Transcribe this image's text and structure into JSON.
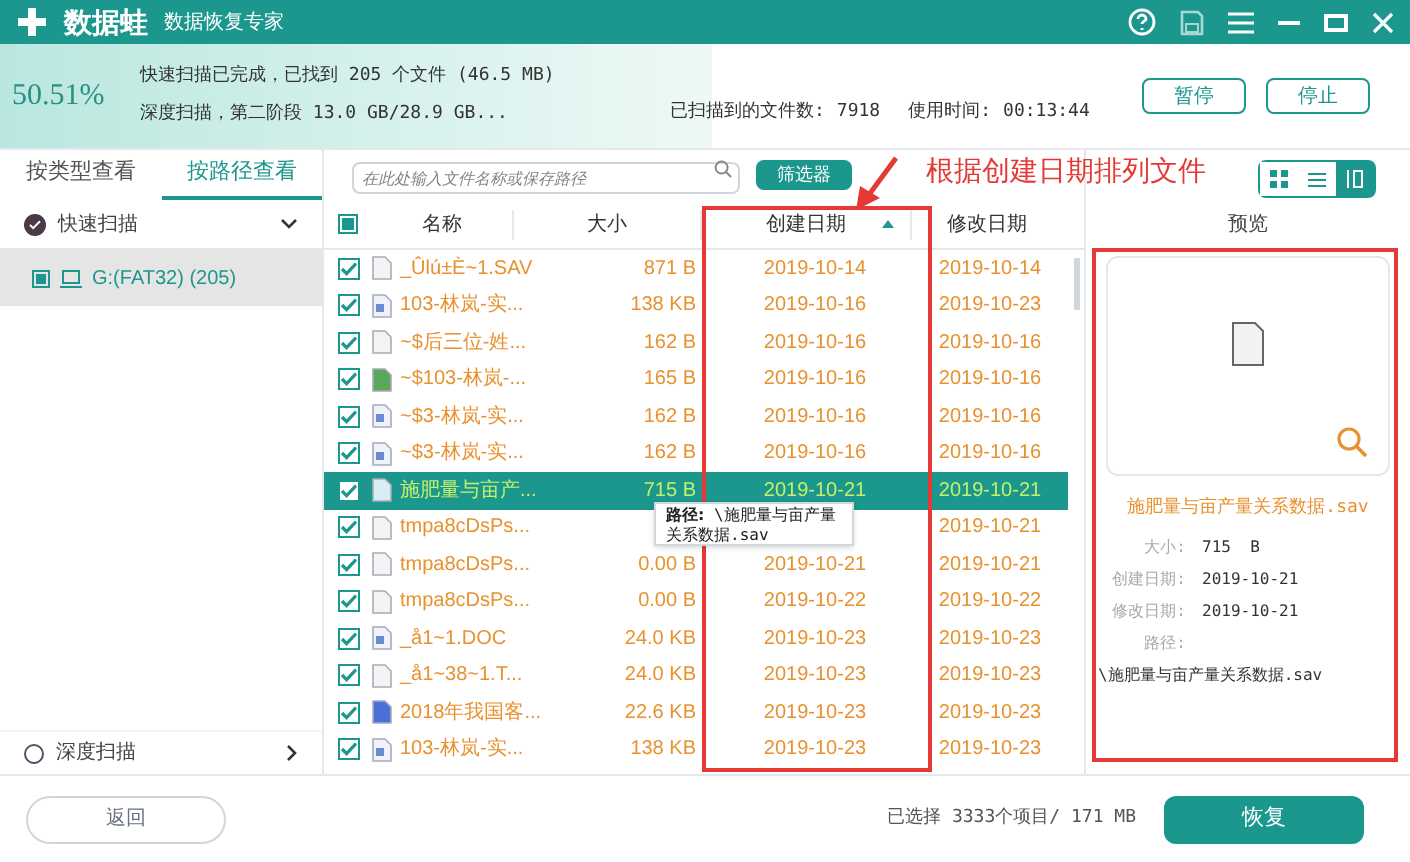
{
  "app": {
    "name": "数据蛙",
    "subtitle": "数据恢复专家"
  },
  "scan": {
    "percent": "50.51%",
    "level": 0.5051,
    "line1": "快速扫描已完成，已找到 205 个文件 (46.5 MB)",
    "line2": "深度扫描，第二阶段 13.0 GB/28.9 GB...",
    "found_label": "已扫描到的文件数:",
    "found": "7918",
    "time_label": "使用时间:",
    "time": "00:13:44",
    "buttons": [
      "暂停",
      "停止"
    ]
  },
  "view_tabs": [
    {
      "label": "按类型查看",
      "selected": false
    },
    {
      "label": "按路径查看",
      "selected": true
    }
  ],
  "quick_scan": {
    "label": "快速扫描",
    "checked": true
  },
  "tree": [
    {
      "label": "G:(FAT32) (205)",
      "selected": true,
      "checked": true
    }
  ],
  "deep_scan": {
    "label": "深度扫描",
    "checked": false
  },
  "search": {
    "placeholder": "在此处输入文件名称或保存路径"
  },
  "filter_button": "筛选器",
  "view_modes": [
    {
      "kind": "grid",
      "selected": false
    },
    {
      "kind": "list",
      "selected": false
    },
    {
      "kind": "detail",
      "selected": true
    }
  ],
  "all_checked": true,
  "columns": [
    "名称",
    "大小",
    "创建日期",
    "修改日期"
  ],
  "rows": [
    {
      "name": "_Ûlú±È~1.SAV",
      "size": "871 B",
      "created": "2019-10-14",
      "modified": "2019-10-14",
      "kind": "blank",
      "checked": true,
      "selected": false
    },
    {
      "name": "103-林岚-实...",
      "size": "138 KB",
      "created": "2019-10-16",
      "modified": "2019-10-23",
      "kind": "doc",
      "checked": true,
      "selected": false
    },
    {
      "name": "~$后三位-姓...",
      "size": "162 B",
      "created": "2019-10-16",
      "modified": "2019-10-16",
      "kind": "blank",
      "checked": true,
      "selected": false
    },
    {
      "name": "~$103-林岚-...",
      "size": "165 B",
      "created": "2019-10-16",
      "modified": "2019-10-16",
      "kind": "sheet",
      "checked": true,
      "selected": false
    },
    {
      "name": "~$3-林岚-实...",
      "size": "162 B",
      "created": "2019-10-16",
      "modified": "2019-10-16",
      "kind": "doc",
      "checked": true,
      "selected": false
    },
    {
      "name": "~$3-林岚-实...",
      "size": "162 B",
      "created": "2019-10-16",
      "modified": "2019-10-16",
      "kind": "doc",
      "checked": true,
      "selected": false
    },
    {
      "name": "施肥量与亩产...",
      "size": "715 B",
      "created": "2019-10-21",
      "modified": "2019-10-21",
      "kind": "data",
      "checked": true,
      "selected": true
    },
    {
      "name": "tmpa8cDsPs...",
      "modified": "2019-10-21",
      "kind": "blank",
      "checked": true,
      "selected": false
    },
    {
      "name": "tmpa8cDsPs...",
      "size": "0.00 B",
      "created": "2019-10-21",
      "modified": "2019-10-21",
      "kind": "blank",
      "checked": true,
      "selected": false
    },
    {
      "name": "tmpa8cDsPs...",
      "size": "0.00 B",
      "created": "2019-10-22",
      "modified": "2019-10-22",
      "kind": "blank",
      "checked": true,
      "selected": false
    },
    {
      "name": "_å1~1.DOC",
      "size": "24.0 KB",
      "created": "2019-10-23",
      "modified": "2019-10-23",
      "kind": "doc",
      "checked": true,
      "selected": false
    },
    {
      "name": "_å1~38~1.T...",
      "size": "24.0 KB",
      "created": "2019-10-23",
      "modified": "2019-10-23",
      "kind": "blank",
      "checked": true,
      "selected": false
    },
    {
      "name": "2018年我国客...",
      "size": "22.6 KB",
      "created": "2019-10-23",
      "modified": "2019-10-23",
      "kind": "image",
      "checked": true,
      "selected": false
    },
    {
      "name": "103-林岚-实...",
      "size": "138 KB",
      "created": "2019-10-23",
      "modified": "2019-10-23",
      "kind": "doc",
      "checked": true,
      "selected": false
    }
  ],
  "tooltip": {
    "label": "路径:",
    "value": "\\施肥量与亩产量关系数据.sav"
  },
  "preview": {
    "title": "预览",
    "file_name": "施肥量与亩产量关系数据.sav",
    "fields": [
      {
        "label": "大小:",
        "value": "715  B"
      },
      {
        "label": "创建日期:",
        "value": "2019-10-21"
      },
      {
        "label": "修改日期:",
        "value": "2019-10-21"
      },
      {
        "label": "路径:"
      }
    ],
    "path": "\\施肥量与亩产量关系数据.sav"
  },
  "annotation": "根据创建日期排列文件",
  "back_button": "返回",
  "status": "已选择 3333个项目/ 171 MB",
  "recover_button": "恢复"
}
